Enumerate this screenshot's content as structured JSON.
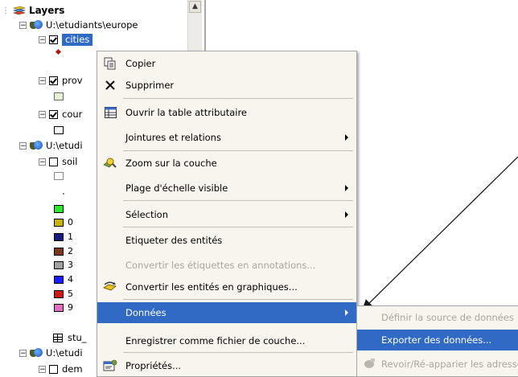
{
  "toc": {
    "root_label": "Layers",
    "group1_label": "U:\\etudiants\\europe",
    "layer_cities": "cities",
    "layer_prov": "prov",
    "layer_cour": "cour",
    "group2_label": "U:\\etudi",
    "layer_soil": "soil",
    "table_stu": "stu_",
    "group3_label": "U:\\etudi",
    "layer_dem": "dem",
    "legend_values": [
      "0",
      "1",
      "2",
      "3",
      "4",
      "5",
      "9"
    ],
    "legend_colors": [
      "#2ee82e",
      "#c8b400",
      "#1a1a7a",
      "#7a3a1a",
      "#a0a0a0",
      "#1a1aff",
      "#cc1a1a",
      "#e070c0"
    ]
  },
  "context_menu": {
    "items": [
      {
        "label": "Copier",
        "icon": "copy-icon",
        "submenu": false,
        "disabled": false
      },
      {
        "label": "Supprimer",
        "icon": "delete-icon",
        "submenu": false,
        "disabled": false
      },
      {
        "label": "Ouvrir la table attributaire",
        "icon": "table-icon",
        "submenu": false,
        "disabled": false
      },
      {
        "label": "Jointures et relations",
        "icon": "",
        "submenu": true,
        "disabled": false
      },
      {
        "label": "Zoom sur la couche",
        "icon": "zoom-layer-icon",
        "submenu": false,
        "disabled": false
      },
      {
        "label": "Plage d'échelle visible",
        "icon": "",
        "submenu": true,
        "disabled": false
      },
      {
        "label": "Sélection",
        "icon": "",
        "submenu": true,
        "disabled": false
      },
      {
        "label": "Etiqueter des entités",
        "icon": "",
        "submenu": false,
        "disabled": false
      },
      {
        "label": "Convertir les étiquettes en annotations...",
        "icon": "",
        "submenu": false,
        "disabled": true
      },
      {
        "label": "Convertir les entités en graphiques...",
        "icon": "convert-graphics-icon",
        "submenu": false,
        "disabled": false
      },
      {
        "label": "Données",
        "icon": "",
        "submenu": true,
        "disabled": false,
        "highlighted": true
      },
      {
        "label": "Enregistrer comme fichier de couche...",
        "icon": "",
        "submenu": false,
        "disabled": false
      },
      {
        "label": "Propriétés...",
        "icon": "properties-icon",
        "submenu": false,
        "disabled": false
      }
    ]
  },
  "submenu": {
    "items": [
      {
        "label": "Définir la source de données",
        "disabled": true
      },
      {
        "label": "Exporter des données...",
        "disabled": false,
        "highlighted": true
      },
      {
        "label": "Revoir/Ré-apparier les adresses",
        "disabled": true
      }
    ]
  },
  "colors": {
    "highlight": "#316ac5",
    "menu_bg": "#f7f5ee",
    "disabled_text": "#a8a79f"
  }
}
